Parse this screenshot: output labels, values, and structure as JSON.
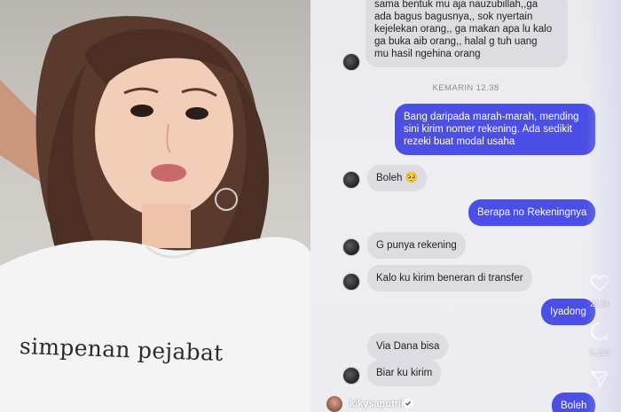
{
  "photo": {
    "shirt_text": "simpenan pejabat"
  },
  "chat": {
    "messages": [
      {
        "id": "m1",
        "direction": "incoming",
        "text": "sama bentuk mu aja nauzubillah,,ga\nada bagus bagusnya,, sok nyertain\nkejelekan orang,, ga makan apa lu kalo\nga buka aib orang,, halal g tuh uang\nmu hasil ngehina orang"
      },
      {
        "id": "m2",
        "direction": "outgoing",
        "text": "Bang daripada marah-marah, mending\nsini kirim nomer rekening. Ada sedikit\nrezeki buat modal usaha"
      },
      {
        "id": "m3",
        "direction": "incoming",
        "text": "Boleh 🥺"
      },
      {
        "id": "m4",
        "direction": "outgoing",
        "text": "Berapa no Rekeningnya"
      },
      {
        "id": "m5",
        "direction": "incoming",
        "text": "G punya rekening"
      },
      {
        "id": "m6",
        "direction": "incoming",
        "text": "Kalo ku kirim beneran di transfer"
      },
      {
        "id": "m7",
        "direction": "outgoing",
        "text": "Iyadong"
      },
      {
        "id": "m8",
        "direction": "incoming",
        "text": "Via Dana bisa"
      },
      {
        "id": "m9",
        "direction": "incoming",
        "text": "Biar ku kirim"
      },
      {
        "id": "m10",
        "direction": "outgoing",
        "text": "Boleh"
      }
    ],
    "timestamp": "KEMARIN 12.38"
  },
  "reel_actions": {
    "likes": "21.5k",
    "comments": "6,133",
    "like_icon": "heart-icon",
    "comment_icon": "comment-icon",
    "share_icon": "send-icon"
  },
  "footer": {
    "username": "kikysaputrii"
  },
  "colors": {
    "incoming_bubble": "#dcdce2",
    "outgoing_bubble": "#4b4fe6",
    "chat_bg": "#ececf1"
  }
}
